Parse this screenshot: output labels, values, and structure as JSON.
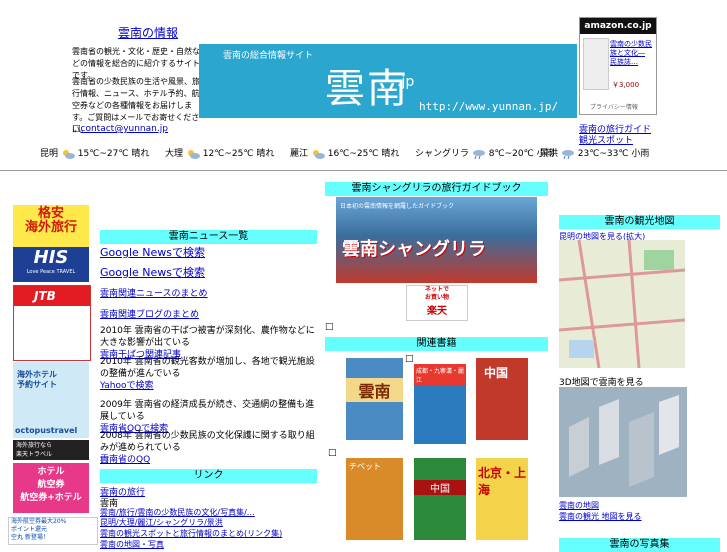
{
  "header": {
    "title_link": "雲南の情報",
    "intro1": "雲南省の観光・文化・歴史・自然などの情報を総合的に紹介するサイトです。",
    "intro2": "雲南省の少数民族の生活や風景、旅行情報、ニュース、ホテル予約、航空券などの各種情報をお届けします。ご質問はメールでお寄せください。",
    "contact": "contact@yunnan.jp",
    "banner_subtitle": "雲南の総合情報サイト",
    "banner_logo": "雲南",
    "banner_domain": ".jp",
    "banner_url": "http://www.yunnan.jp/"
  },
  "amazon": {
    "logo": "amazon.co.jp",
    "item_title": "雲南の少数民族と文化―\n民族誌…",
    "price": "￥3,000",
    "footer": "プライバシー情報"
  },
  "right_links": {
    "link1": "雲南の旅行ガイド",
    "link2": "観光スポット"
  },
  "weather": [
    {
      "city": "昆明",
      "icon": "partly-cloudy-icon",
      "temp": "15℃~27℃",
      "tail": "晴れ"
    },
    {
      "city": "大理",
      "icon": "partly-cloudy-icon",
      "temp": "12℃~25℃",
      "tail": "晴れ"
    },
    {
      "city": "麗江",
      "icon": "partly-cloudy-icon",
      "temp": "16℃~25℃",
      "tail": "晴れ"
    },
    {
      "city": "シャングリラ",
      "icon": "rain-icon",
      "temp": "8℃~20℃",
      "tail": "小雨"
    },
    {
      "city": "景洪",
      "icon": "rain-icon",
      "temp": "23℃~33℃",
      "tail": "小雨"
    }
  ],
  "left_ads": {
    "ad1": "格安\n海外旅行",
    "ad1_brand": "HIS",
    "ad1_tag": "Love Peace TRAVEL",
    "ad2": "JTB",
    "ad3": "海外ホテル\n予約サイト",
    "ad3_brand": "octopustravel",
    "ad4": "海外旅行なら\n楽天トラベル",
    "ad5": "ホテル\n航空券\n航空券+ホテル",
    "ad6": "海外航空券最大20%\nポイント還元\n空丸 新登場！"
  },
  "news": {
    "heading": "雲南ニュース一覧",
    "link1": "Google Newsで検索",
    "link2": "Google Newsで検索",
    "link3": "雲南関連ニュースのまとめ",
    "link4": "雲南関連ブログのまとめ",
    "item1_text": "2010年 雲南省の干ばつ被害が深刻化、農作物などに大きな影響が出ている",
    "item1_link": "雲南干ばつ関連記事",
    "item2_text": "2010年 雲南省の観光客数が増加し、各地で観光施設の整備が進んでいる",
    "item2_link": "Yahooで検索",
    "item3_text": "2009年 雲南省の経済成長が続き、交通網の整備も進展している",
    "item3_link": "雲南省QQで検索",
    "item4_text": "2008年 雲南省の少数民族の文化保護に関する取り組みが進められている",
    "item4_link": "雲南省のQQ",
    "bullet": "□"
  },
  "links_section": {
    "heading": "リンク",
    "link1": "雲南の旅行",
    "line2": "雲南",
    "line3": "雲南/旅行/雲南の少数民族の文化/写真集/…",
    "line4": "昆明/大理/麗江/シャングリラ/景洪",
    "line5": "雲南の観光スポットと旅行情報のまとめ(リンク集)",
    "line6": "雲南の地図・写真"
  },
  "center": {
    "heading1": "雲南シャングリラの旅行ガイドブック",
    "book_banner_top": "日本初の雲南情報を網羅したガイドブック",
    "book_banner_title": "雲南シャングリラ",
    "rakuten_text": "ネットで\nお買い物",
    "rakuten_brand": "楽天",
    "heading2": "関連書籍",
    "book1": "雲南",
    "book2": "成都・九寨溝・麗江",
    "book3": "中国",
    "book4": "チベット",
    "book5": "中国",
    "book6": "北京・上海",
    "bullet": "□"
  },
  "right": {
    "heading1": "雲南の観光地図",
    "map_link": "昆明の地図を見る(拡大)",
    "map3d_label": "3D地図で雲南を見る",
    "link_a": "雲南の地図",
    "link_b": "雲南の観光 地図を見る",
    "heading2": "雲南の写真集"
  }
}
